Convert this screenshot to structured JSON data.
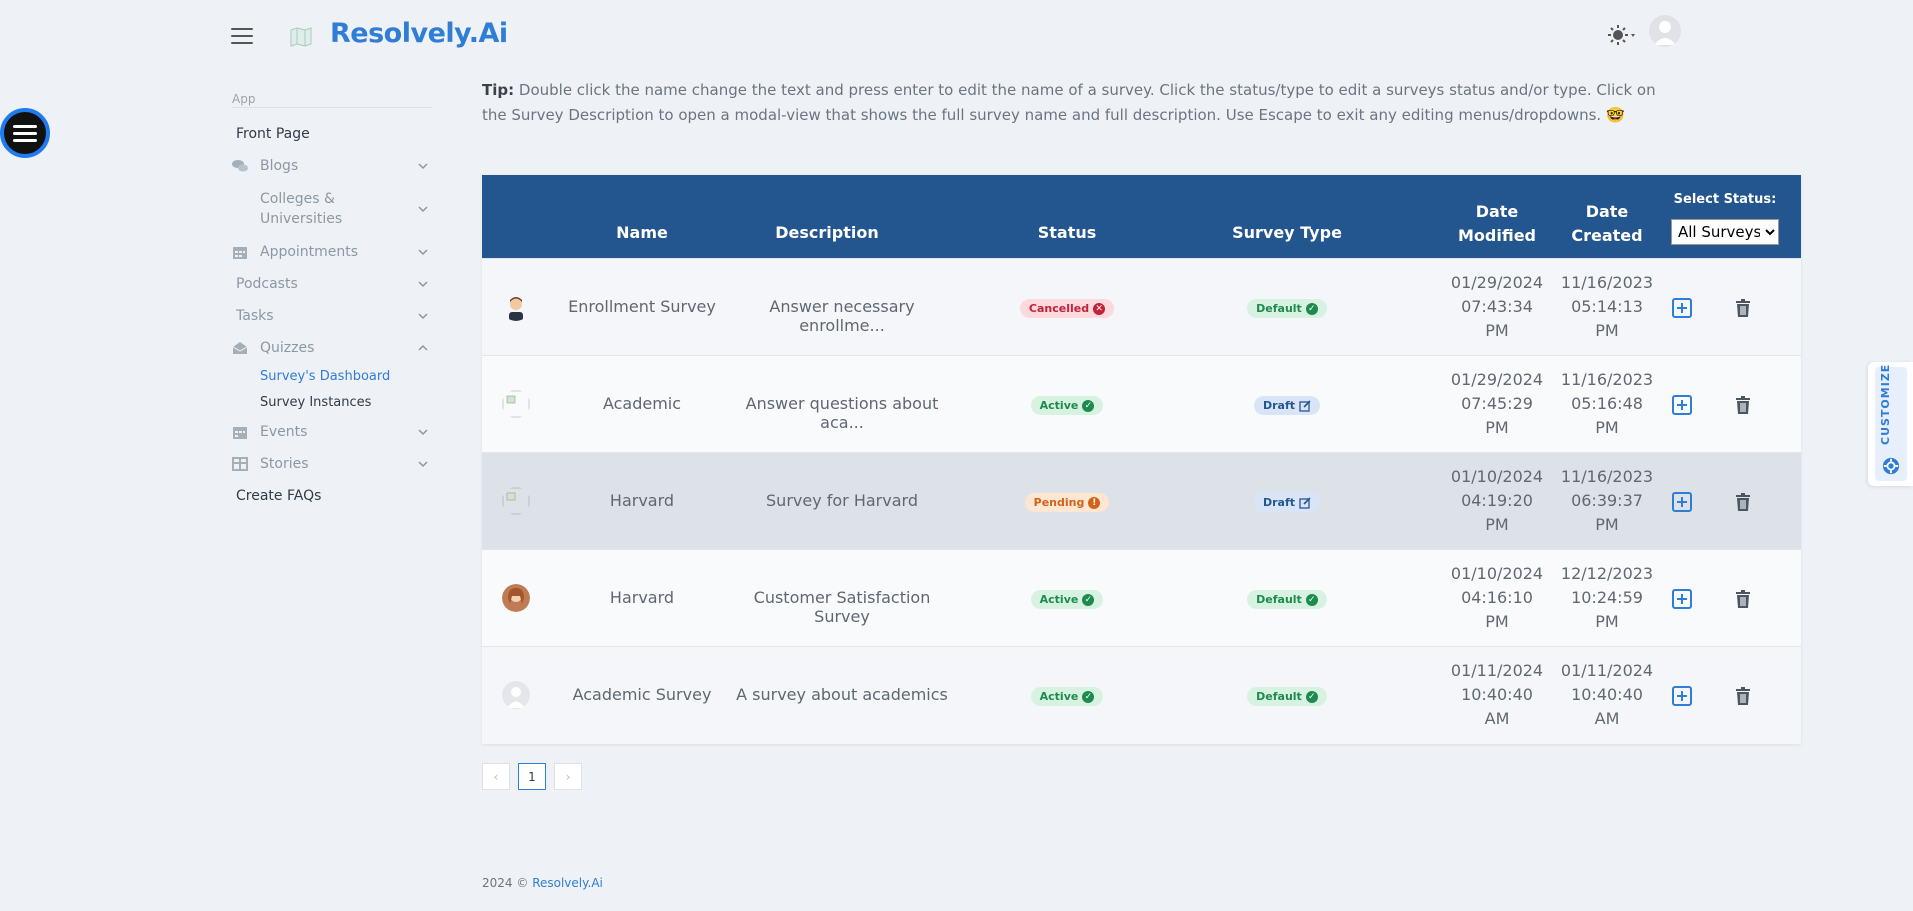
{
  "header": {
    "brand": "Resolvely.Ai"
  },
  "sidebar": {
    "section_label": "App",
    "items": [
      {
        "label": "Front Page"
      },
      {
        "label": "Blogs"
      },
      {
        "label": "Colleges & Universities"
      },
      {
        "label": "Appointments"
      },
      {
        "label": "Podcasts"
      },
      {
        "label": "Tasks"
      },
      {
        "label": "Quizzes"
      },
      {
        "label": "Events"
      },
      {
        "label": "Stories"
      },
      {
        "label": "Create FAQs"
      }
    ],
    "quiz_sub": [
      {
        "label": "Survey's Dashboard"
      },
      {
        "label": "Survey Instances"
      }
    ]
  },
  "tip": {
    "label": "Tip:",
    "text": "Double click the name change the text and press enter to edit the name of a survey. Click the status/type to edit a surveys status and/or type. Click on the Survey Description to open a modal-view that shows the full survey name and full description. Use Escape to exit any editing menus/dropdowns. 🤓"
  },
  "table": {
    "headers": {
      "name": "Name",
      "description": "Description",
      "status": "Status",
      "type": "Survey Type",
      "modified_1": "Date",
      "modified_2": "Modified",
      "created_1": "Date",
      "created_2": "Created",
      "select_label": "Select Status:"
    },
    "select_value": "All Surveys",
    "rows": [
      {
        "name": "Enrollment Survey",
        "description": "Answer necessary enrollme...",
        "status": "Cancelled",
        "type": "Default",
        "mod": [
          "01/29/2024",
          "07:43:34",
          "PM"
        ],
        "cre": [
          "11/16/2023",
          "05:14:13",
          "PM"
        ]
      },
      {
        "name": "Academic",
        "description": "Answer questions about aca...",
        "status": "Active",
        "type": "Draft",
        "mod": [
          "01/29/2024",
          "07:45:29",
          "PM"
        ],
        "cre": [
          "11/16/2023",
          "05:16:48",
          "PM"
        ]
      },
      {
        "name": "Harvard",
        "description": "Survey for Harvard",
        "status": "Pending",
        "type": "Draft",
        "mod": [
          "01/10/2024",
          "04:19:20",
          "PM"
        ],
        "cre": [
          "11/16/2023",
          "06:39:37",
          "PM"
        ]
      },
      {
        "name": "Harvard",
        "description": "Customer Satisfaction Survey",
        "status": "Active",
        "type": "Default",
        "mod": [
          "01/10/2024",
          "04:16:10",
          "PM"
        ],
        "cre": [
          "12/12/2023",
          "10:24:59",
          "PM"
        ]
      },
      {
        "name": "Academic Survey",
        "description": "A survey about academics",
        "status": "Active",
        "type": "Default",
        "mod": [
          "01/11/2024",
          "10:40:40",
          "AM"
        ],
        "cre": [
          "01/11/2024",
          "10:40:40",
          "AM"
        ]
      }
    ]
  },
  "pagination": {
    "prev": "‹",
    "page": "1",
    "next": "›"
  },
  "footer": {
    "year": "2024 ©",
    "link": "Resolvely.Ai"
  },
  "customize": {
    "label": "CUSTOMIZE"
  },
  "colors": {
    "brand": "#2f7dd6",
    "table_header": "#23558f"
  }
}
